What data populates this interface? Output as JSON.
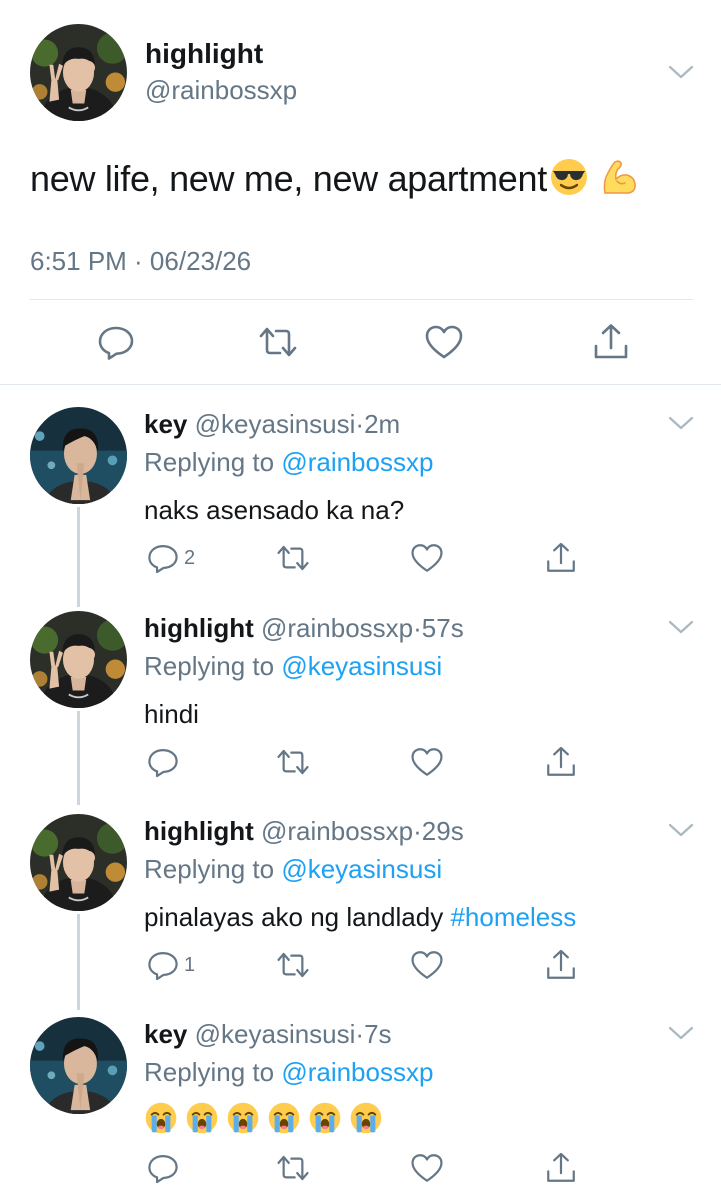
{
  "main_tweet": {
    "name": "highlight",
    "handle": "@rainbossxp",
    "text": "new life, new me, new apartment",
    "emojis": [
      "smiling-face-with-sunglasses",
      "flexed-biceps"
    ],
    "timestamp": "6:51 PM · 06/23/26"
  },
  "replies": [
    {
      "name": "key",
      "handle": "@keyasinsusi",
      "dot": "·",
      "time": "2m",
      "replying_prefix": "Replying to ",
      "replying_to": "@rainbossxp",
      "text": "naks asensado ka na?",
      "reply_count": "2"
    },
    {
      "name": "highlight",
      "handle": "@rainbossxp",
      "dot": "·",
      "time": "57s",
      "replying_prefix": "Replying to ",
      "replying_to": "@keyasinsusi",
      "text": "hindi",
      "reply_count": ""
    },
    {
      "name": "highlight",
      "handle": "@rainbossxp",
      "dot": "·",
      "time": "29s",
      "replying_prefix": "Replying to ",
      "replying_to": "@keyasinsusi",
      "text": "pinalayas ako ng landlady ",
      "hashtag": "#homeless",
      "reply_count": "1"
    },
    {
      "name": "key",
      "handle": "@keyasinsusi",
      "dot": "·",
      "time": "7s",
      "replying_prefix": "Replying to ",
      "replying_to": "@rainbossxp",
      "emojis": [
        "loudly-crying-face",
        "loudly-crying-face",
        "loudly-crying-face",
        "loudly-crying-face",
        "loudly-crying-face",
        "loudly-crying-face"
      ],
      "reply_count": ""
    }
  ],
  "colors": {
    "text": "#14171a",
    "secondary": "#657786",
    "link": "#1da1f2",
    "divider": "#e1e8ed",
    "thread_line": "#ccd6dd"
  }
}
